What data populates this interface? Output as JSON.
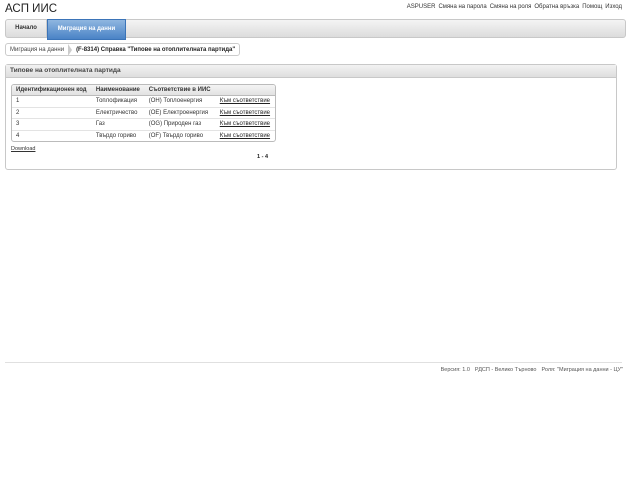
{
  "app": {
    "title": "АСП ИИС"
  },
  "top_links": [
    "ASPUSER",
    "Смяна на парола",
    "Смяна на роля",
    "Обратна връзка",
    "Помощ",
    "Изход"
  ],
  "nav": {
    "home": "Начало",
    "active": "Миграция на данни"
  },
  "breadcrumb": {
    "parent": "Миграция на данни",
    "current": "(F-8314) Справка \"Типове на отоплителната партида\""
  },
  "panel": {
    "title": "Типове на отоплителната партида"
  },
  "table": {
    "headers": [
      "Идентификационен код",
      "Наименование",
      "Съответствие в ИИС",
      ""
    ],
    "rows": [
      [
        "1",
        "Топлофикация",
        "(OH) Топлоенергия",
        "Към съответствие"
      ],
      [
        "2",
        "Електричество",
        "(OE) Електроенергия",
        "Към съответствие"
      ],
      [
        "3",
        "Газ",
        "(OG) Природен газ",
        "Към съответствие"
      ],
      [
        "4",
        "Твърдо гориво",
        "(OF) Твърдо гориво",
        "Към съответствие"
      ]
    ]
  },
  "download": "Download",
  "pager": "1 - 4",
  "footer": [
    "Версия: 1.0",
    "РДСП - Велико Търново",
    "Роля: \"Миграция на данни - ЦУ\""
  ]
}
